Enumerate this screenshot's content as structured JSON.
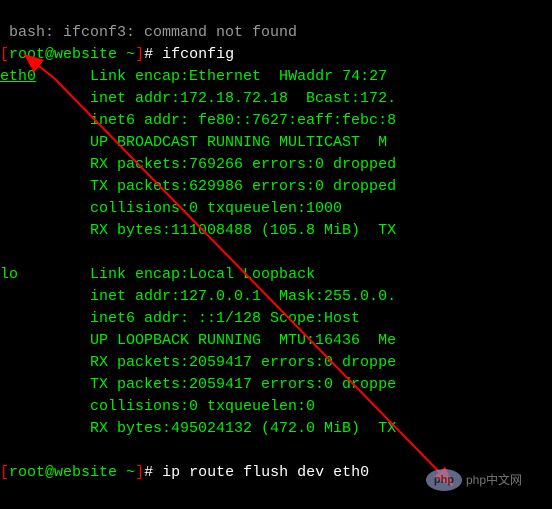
{
  "prompt": {
    "bracket_open": "[",
    "user_host": "root@website",
    "tilde": " ~",
    "bracket_close": "]",
    "hash": "# "
  },
  "header_gray": " bash: ifconf3: command not found",
  "cmd1": "ifconfig",
  "eth0": {
    "name": "eth0",
    "pad": "      ",
    "link": "Link encap:Ethernet  HWaddr 74:27",
    "inet": "inet addr:172.18.72.18  Bcast:172.",
    "inet6": "inet6 addr: fe80::7627:eaff:febc:8",
    "up": "UP BROADCAST RUNNING MULTICAST  M",
    "rxp": "RX packets:769266 errors:0 dropped",
    "txp": "TX packets:629986 errors:0 dropped",
    "col": "collisions:0 txqueuelen:1000",
    "rxb": "RX bytes:111008488 (105.8 MiB)  TX"
  },
  "lo": {
    "name": "lo",
    "pad": "        ",
    "link": "Link encap:Local Loopback",
    "inet": "inet addr:127.0.0.1  Mask:255.0.0.",
    "inet6": "inet6 addr: ::1/128 Scope:Host",
    "up": "UP LOOPBACK RUNNING  MTU:16436  Me",
    "rxp": "RX packets:2059417 errors:0 droppe",
    "txp": "TX packets:2059417 errors:0 droppe",
    "col": "collisions:0 txqueuelen:0",
    "rxb": "RX bytes:495024132 (472.0 MiB)  TX"
  },
  "cmd2": "ip route flush dev eth0",
  "indent": "          ",
  "watermark": {
    "logo": "php",
    "text": "php中文网"
  }
}
